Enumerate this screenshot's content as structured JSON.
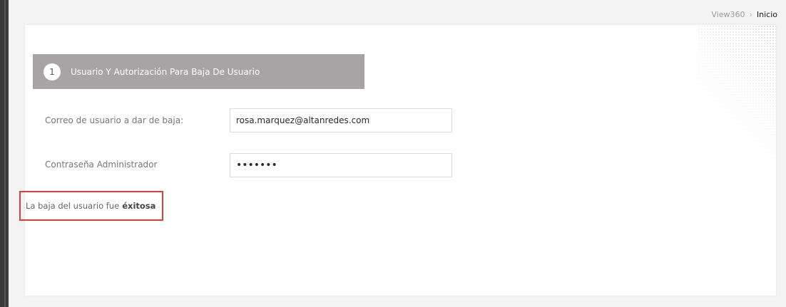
{
  "breadcrumb": {
    "root": "View360",
    "separator": "›",
    "current": "Inicio"
  },
  "step": {
    "number": "1",
    "title": "Usuario Y Autorización Para Baja De Usuario"
  },
  "form": {
    "email_label": "Correo de usuario a dar de baja:",
    "email_value": "rosa.marquez@altanredes.com",
    "password_label": "Contraseña Administrador",
    "password_value": "•••••••"
  },
  "message": {
    "text": "La baja del usuario fue",
    "emphasis": "éxitosa"
  },
  "colors": {
    "header_bg": "#a8a4a5",
    "highlight_border": "#d9403f",
    "page_bg": "#f3f3f3",
    "left_bar": "#3a3a3a"
  }
}
